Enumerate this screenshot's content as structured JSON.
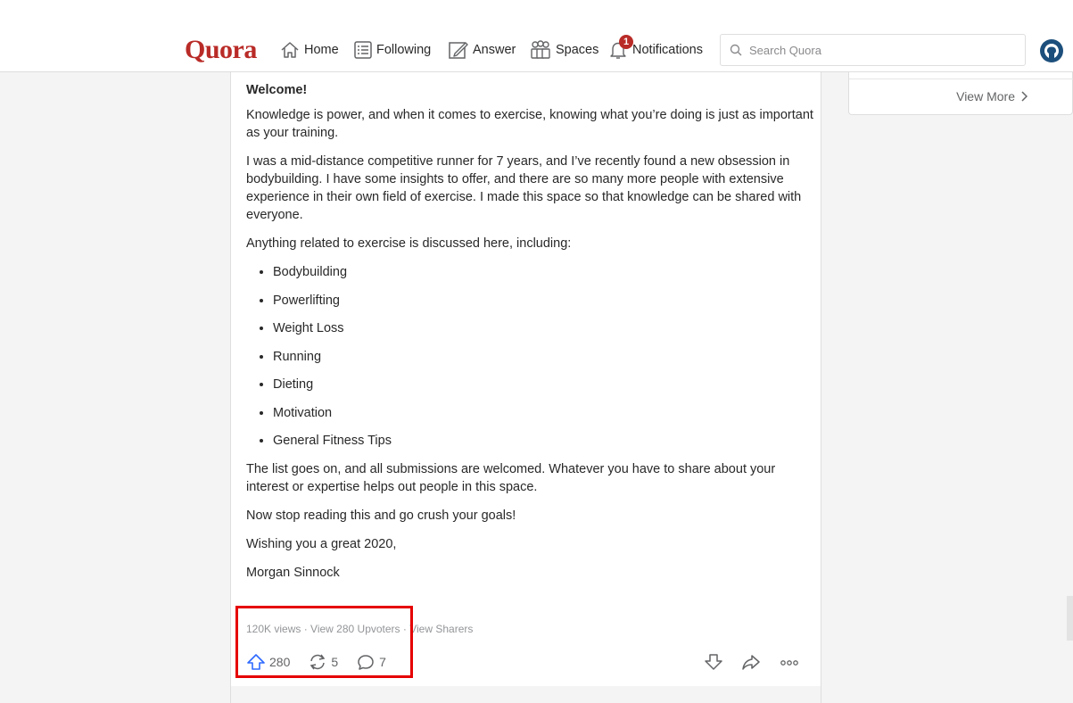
{
  "header": {
    "logo": "Quora",
    "nav": {
      "home": "Home",
      "following": "Following",
      "answer": "Answer",
      "spaces": "Spaces",
      "notifications": "Notifications",
      "notifications_badge": "1"
    },
    "search_placeholder": "Search Quora"
  },
  "post": {
    "heading": "Welcome!",
    "paragraphs": [
      "Knowledge is power, and when it comes to exercise, knowing what you’re doing is just as important as your training.",
      "I was a mid-distance competitive runner for 7 years, and I’ve recently found a new obsession in bodybuilding. I have some insights to offer, and there are so many more people with extensive experience in their own field of exercise. I made this space so that knowledge can be shared with everyone.",
      "Anything related to exercise is discussed here, including:"
    ],
    "topics": [
      "Bodybuilding",
      "Powerlifting",
      "Weight Loss",
      "Running",
      "Dieting",
      "Motivation",
      "General Fitness Tips"
    ],
    "closing": [
      "The list goes on, and all submissions are welcomed. Whatever you have to share about your interest or expertise helps out people in this space.",
      "Now stop reading this and go crush your goals!",
      "Wishing you a great 2020,"
    ],
    "signature": "Morgan Sinnock",
    "meta": {
      "views": "120K views",
      "separator": " · ",
      "upvoters": "View 280 Upvoters",
      "sharers": "View Sharers"
    },
    "actions": {
      "upvotes": "280",
      "shares": "5",
      "comments": "7"
    }
  },
  "sidebar": {
    "view_more": "View More"
  },
  "colors": {
    "brand": "#b92b27",
    "upvote": "#2e69ff",
    "highlight": "#e60000"
  }
}
